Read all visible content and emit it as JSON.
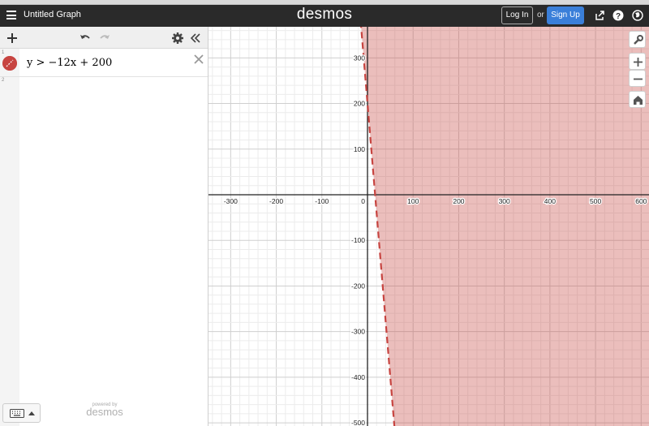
{
  "header": {
    "title": "Untitled Graph",
    "brand": "desmos",
    "login_label": "Log In",
    "or_label": "or",
    "signup_label": "Sign Up"
  },
  "expressions": [
    {
      "index": "1",
      "latex": "y > −12x + 200",
      "color": "#c74440"
    },
    {
      "index": "2",
      "latex": ""
    }
  ],
  "footer": {
    "powered_by": "powered by",
    "brand": "desmos"
  },
  "graph": {
    "x_ticks": [
      "-300",
      "-200",
      "-100",
      "0",
      "100",
      "200",
      "300",
      "400",
      "500",
      "600"
    ],
    "y_ticks": [
      "300",
      "200",
      "100",
      "-100",
      "-200",
      "-300",
      "-400",
      "-500"
    ],
    "inequality": {
      "slope": -12,
      "intercept": 200,
      "type": "greater",
      "color": "#c74440"
    }
  },
  "colors": {
    "accent": "#3a7fd9",
    "header_bg": "#2a2a2a",
    "shade": "#c74440"
  }
}
